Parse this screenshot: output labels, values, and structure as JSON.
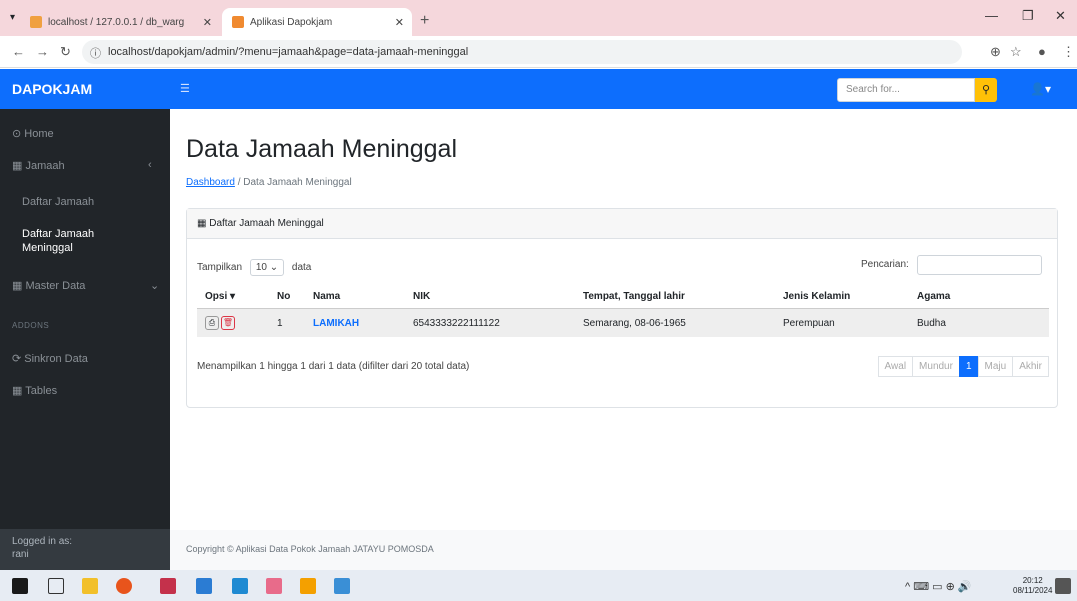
{
  "browser": {
    "tab1_title": "localhost / 127.0.0.1 / db_warg",
    "tab2_title": "Aplikasi Dapokjam",
    "url": "localhost/dapokjam/admin/?menu=jamaah&page=data-jamaah-meninggal"
  },
  "topnav": {
    "brand": "DAPOKJAM",
    "search_placeholder": "Search for..."
  },
  "sidebar": {
    "home": "Home",
    "jamaah": "Jamaah",
    "daftar_jamaah": "Daftar Jamaah",
    "daftar_meninggal": "Daftar Jamaah Meninggal",
    "master_data": "Master Data",
    "heading": "ADDONS",
    "sinkron": "Sinkron Data",
    "tables": "Tables",
    "logged_in_label": "Logged in as:",
    "logged_in_user": "rani"
  },
  "page": {
    "title": "Data Jamaah Meninggal",
    "breadcrumb_home": "Dashboard",
    "breadcrumb_sep": "/",
    "breadcrumb_current": "Data Jamaah Meninggal",
    "card_title": "Daftar Jamaah Meninggal",
    "show_label": "Tampilkan",
    "show_value": "10",
    "show_suffix": "data",
    "search_label": "Pencarian:",
    "info": "Menampilkan 1 hingga 1 dari 1 data (difilter dari 20 total data)",
    "footer": "Copyright © Aplikasi Data Pokok Jamaah JATAYU POMOSDA"
  },
  "table": {
    "headers": [
      "Opsi",
      "No",
      "Nama",
      "NIK",
      "Tempat, Tanggal lahir",
      "Jenis Kelamin",
      "Agama"
    ],
    "row": {
      "no": "1",
      "nama": "LAMIKAH",
      "nik": "6543333222111122",
      "ttl": "Semarang, 08-06-1965",
      "jk": "Perempuan",
      "agama": "Budha"
    }
  },
  "pager": {
    "first": "Awal",
    "prev": "Mundur",
    "current": "1",
    "next": "Maju",
    "last": "Akhir"
  },
  "clock": {
    "time": "20:12",
    "date": "08/11/2024"
  }
}
